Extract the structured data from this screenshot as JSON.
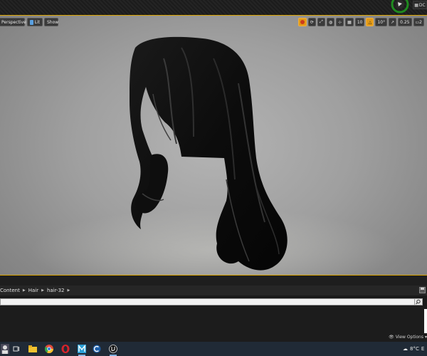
{
  "topbar": {
    "right_button_label": "DC"
  },
  "viewport": {
    "perspective_label": "Perspective",
    "lit_label": "Lit",
    "show_label": "Show",
    "grid_snap_value": "10",
    "rotation_snap_value": "10°",
    "scale_snap_value": "0.25",
    "camera_speed_value": "2",
    "accent_color": "#d8a200"
  },
  "content_browser": {
    "breadcrumb": [
      "Content",
      "Hair",
      "hair-32"
    ],
    "search_placeholder": "",
    "view_options_label": "View Options"
  },
  "taskbar": {
    "weather_temp": "8°C",
    "weather_suffix": "E"
  }
}
